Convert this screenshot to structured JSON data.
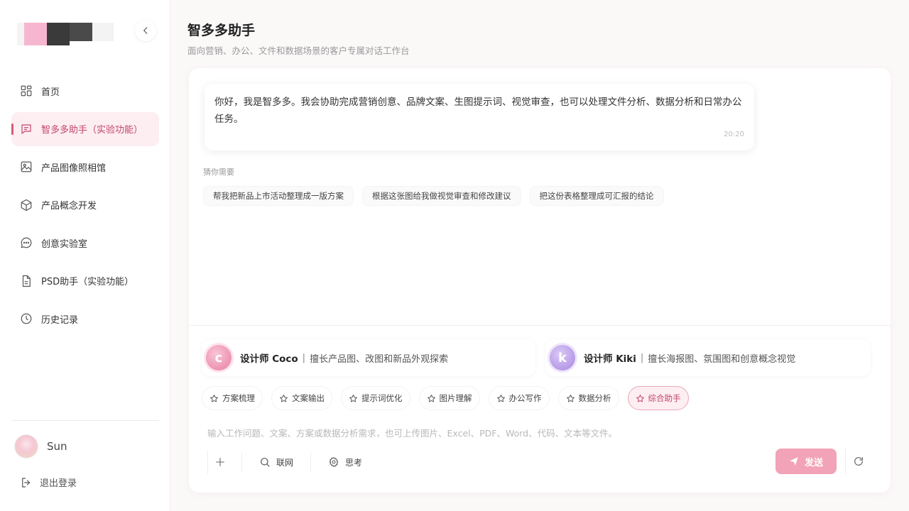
{
  "sidebar": {
    "items": [
      {
        "label": "首页",
        "icon": "grid-icon"
      },
      {
        "label": "智多多助手（实验功能）",
        "icon": "chat-icon",
        "active": true
      },
      {
        "label": "产品图像照相馆",
        "icon": "image-icon"
      },
      {
        "label": "产品概念开发",
        "icon": "cube-icon"
      },
      {
        "label": "创意实验室",
        "icon": "message-bubble-icon"
      },
      {
        "label": "PSD助手（实验功能）",
        "icon": "file-icon"
      },
      {
        "label": "历史记录",
        "icon": "clock-icon"
      }
    ],
    "user_name": "Sun",
    "logout_label": "退出登录"
  },
  "header": {
    "title": "智多多助手",
    "subtitle": "面向营销、办公、文件和数据场景的客户专属对话工作台"
  },
  "chat": {
    "greeting": "你好，我是智多多。我会协助完成营销创意、品牌文案、生图提示词、视觉审查，也可以处理文件分析、数据分析和日常办公任务。",
    "time": "20:20",
    "guess_label": "猜你需要",
    "suggestions": [
      "帮我把新品上市活动整理成一版方案",
      "根据这张图给我做视觉审查和修改建议",
      "把这份表格整理成可汇报的结论"
    ]
  },
  "designers": {
    "coco": {
      "initial": "c",
      "name": "设计师 Coco",
      "sep": "|",
      "desc": "擅长产品图、改图和新品外观探索"
    },
    "kiki": {
      "initial": "k",
      "name": "设计师 Kiki",
      "sep": "|",
      "desc": "擅长海报图、氛围图和创意概念视觉"
    }
  },
  "skills": [
    "方案梳理",
    "文案输出",
    "提示词优化",
    "图片理解",
    "办公写作",
    "数据分析",
    "综合助手"
  ],
  "active_skill": "综合助手",
  "input": {
    "placeholder": "输入工作问题、文案、方案或数据分析需求，也可上传图片、Excel、PDF、Word、代码、文本等文件。",
    "value": ""
  },
  "toolbar": {
    "web_label": "联网",
    "think_label": "思考",
    "send_label": "发送"
  },
  "colors": {
    "accent": "#d45a7c",
    "active_bg": "#fdeef1",
    "send_bg": "#f2a3b7"
  }
}
